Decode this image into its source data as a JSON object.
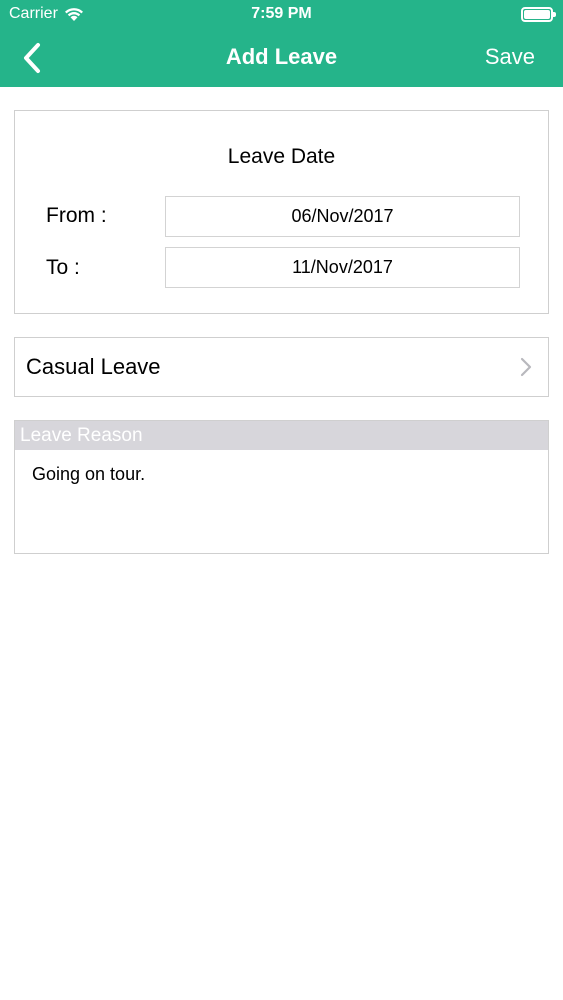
{
  "status_bar": {
    "carrier": "Carrier",
    "time": "7:59 PM"
  },
  "nav": {
    "title": "Add Leave",
    "save_label": "Save",
    "back_icon": "chevron-left-icon"
  },
  "leave_date": {
    "title": "Leave Date",
    "from_label": "From :",
    "from_value": "06/Nov/2017",
    "to_label": "To :",
    "to_value": "11/Nov/2017"
  },
  "leave_type": {
    "value": "Casual Leave",
    "icon": "chevron-right-icon"
  },
  "leave_reason": {
    "header": "Leave Reason",
    "text": "Going on tour."
  },
  "colors": {
    "brand": "#25b48a",
    "reason_header_bg": "#d7d6db",
    "border": "#cfcfcf"
  }
}
